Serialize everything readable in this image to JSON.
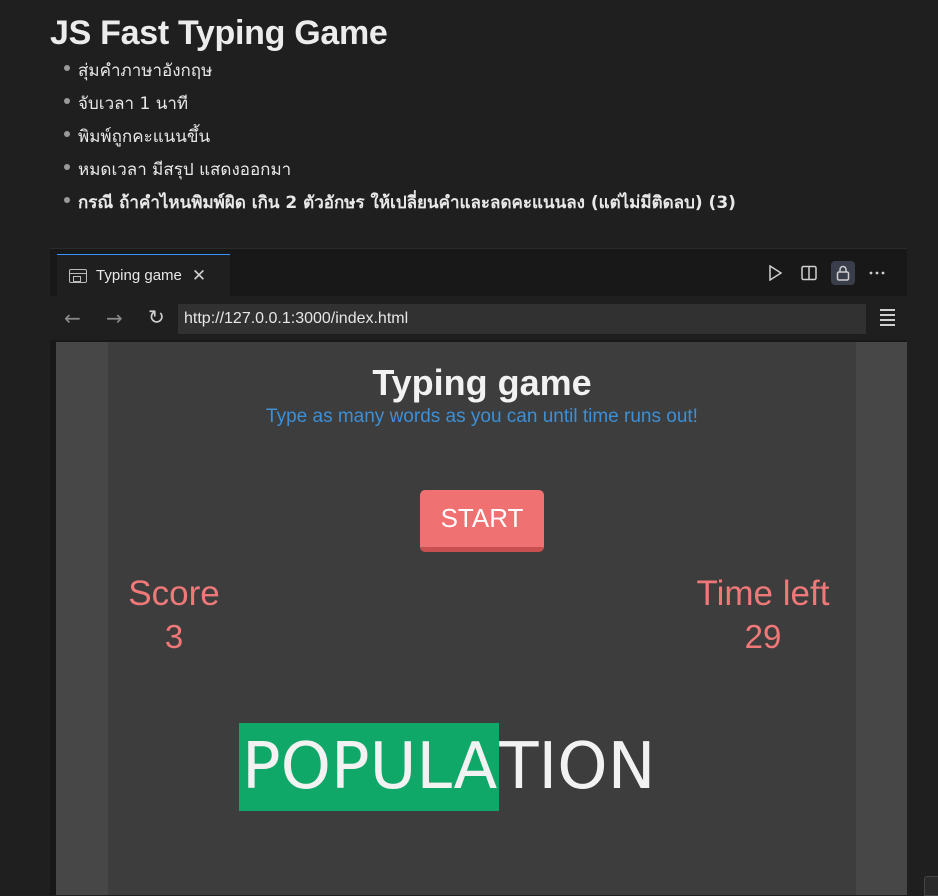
{
  "doc": {
    "title": "JS Fast Typing Game",
    "bullets": [
      "สุ่มคำภาษาอังกฤษ",
      "จับเวลา 1 นาที",
      "พิมพ์ถูกคะแนนขึ้น",
      "หมดเวลา มีสรุป แสดงออกมา",
      "กรณี ถ้าคำไหนพิมพ์ผิด เกิน 2 ตัวอักษร ให้เปลี่ยนคำและลดคะแนนลง (แต่ไม่มีติดลบ) (3)"
    ]
  },
  "browser": {
    "tab_label": "Typing game",
    "tab_close": "✕",
    "url": "http://127.0.0.1:3000/index.html",
    "icons": [
      "play-icon",
      "split-editor-icon",
      "lock-icon",
      "more-icon",
      "back-icon",
      "forward-icon",
      "reload-icon",
      "menu-icon"
    ]
  },
  "game": {
    "title": "Typing game",
    "subtitle": "Type as many words as you can until time runs out!",
    "start_label": "START",
    "score_label": "Score",
    "score_value": "3",
    "time_label": "Time left",
    "time_value": "29",
    "word_typed": "POPULA",
    "word_rest": "TION",
    "colors": {
      "accent_red": "#f07171",
      "typed_highlight": "#0fa868",
      "subtitle_blue": "#3d8fd6"
    }
  }
}
